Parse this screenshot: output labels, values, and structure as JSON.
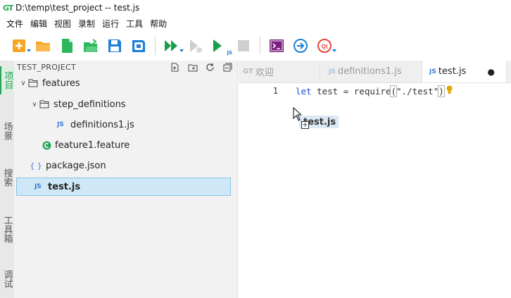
{
  "window": {
    "logo": "GT",
    "title": "D:\\temp\\test_project -- test.js"
  },
  "menu": [
    "文件",
    "编辑",
    "视图",
    "录制",
    "运行",
    "工具",
    "帮助"
  ],
  "toolbar": {
    "icons": [
      "new-file-icon",
      "open-folder-icon",
      "new-document-icon",
      "open-file-icon",
      "save-icon",
      "save-all-icon",
      "run-all-icon",
      "run-step-icon",
      "run-js-icon",
      "stop-icon",
      "terminal-icon",
      "navigate-icon",
      "qt-icon"
    ],
    "run_js_label": "JS"
  },
  "side_tabs": [
    "项目",
    "场景",
    "搜索",
    "工具箱",
    "调试"
  ],
  "explorer": {
    "title": "TEST_PROJECT",
    "tree": [
      {
        "label": "features",
        "type": "folder",
        "expanded": true
      },
      {
        "label": "step_definitions",
        "type": "folder",
        "expanded": true
      },
      {
        "label": "definitions1.js",
        "type": "js",
        "badge": "JS"
      },
      {
        "label": "feature1.feature",
        "type": "feature"
      },
      {
        "label": "package.json",
        "type": "json",
        "badge": "{ }"
      },
      {
        "label": "test.js",
        "type": "js",
        "badge": "JS",
        "selected": true
      }
    ]
  },
  "editor": {
    "tabs": [
      {
        "tag": "GT",
        "label": "欢迎",
        "active": false
      },
      {
        "tag": "JS",
        "label": "definitions1.js",
        "active": false
      },
      {
        "tag": "JS",
        "label": "test.js",
        "active": true,
        "dirty": "●"
      }
    ],
    "line_number": "1",
    "code": {
      "keyword": "let",
      "ident": " test = ",
      "fn": "require",
      "open": "(",
      "string": "\"./test\"",
      "close": ")"
    }
  },
  "drag": {
    "label": "test.js"
  },
  "colors": {
    "accent_green": "#2aa35a",
    "selection": "#cfe8f7",
    "js_blue": "#3b7ad8"
  }
}
